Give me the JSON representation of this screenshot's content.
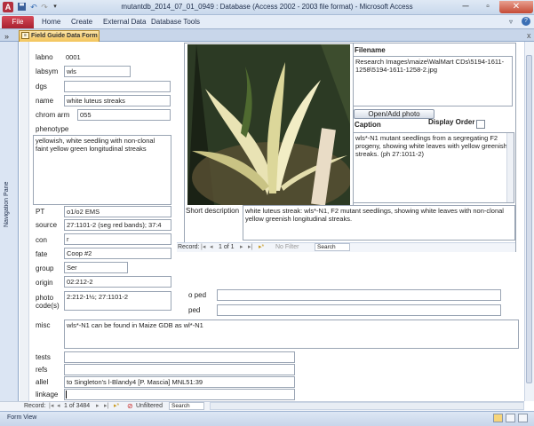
{
  "window": {
    "title": "mutantdb_2014_07_01_0949 : Database (Access 2002 - 2003 file format) - Microsoft Access",
    "app_icon_letter": "A",
    "minimize_glyph": "─",
    "restore_glyph": "▫",
    "close_glyph": "✕"
  },
  "ribbon": {
    "file": "File",
    "tabs": [
      "Home",
      "Create",
      "External Data",
      "Database Tools"
    ],
    "help_glyph": "?"
  },
  "document": {
    "tab_label": "Field Guide Data Form",
    "close_glyph": "x"
  },
  "nav_pane": {
    "label": "Navigation Pane",
    "toggle": "»"
  },
  "form": {
    "labno_label": "labno",
    "labno": "0001",
    "labsym_label": "labsym",
    "labsym": "wls",
    "dgs_label": "dgs",
    "dgs": "",
    "name_label": "name",
    "name": "white luteus streaks",
    "chrom_arm_label": "chrom arm",
    "chrom_arm": "055",
    "phenotype_label": "phenotype",
    "phenotype": "yellowish, white seedling with non-clonal faint yellow green longitudinal streaks",
    "pt_label": "PT",
    "pt": "o1/o2 EMS",
    "source_label": "source",
    "source": "27:1101-2 (seg red bands); 37:4",
    "con_label": "con",
    "con": "r",
    "fate_label": "fate",
    "fate": "Coop #2",
    "group_label": "group",
    "group": "Ser",
    "origin_label": "origin",
    "origin": "02:212-2",
    "photo_codes_label": "photo code(s)",
    "photo_codes": "2:212-1½; 27:1101-2",
    "o_ped_label": "o ped",
    "o_ped": "",
    "ped_label": "ped",
    "ped": "",
    "misc_label": "misc",
    "misc": "wls*-N1 can be found in Maize GDB as wl*-N1",
    "tests_label": "tests",
    "tests": "",
    "refs_label": "refs",
    "refs": "",
    "allel_label": "allel",
    "allel": "to Singleton's l-Blandy4 [P. Mascia] MNL51:39",
    "linkage_label": "linkage",
    "linkage": ""
  },
  "image_subform": {
    "filename_label": "Filename",
    "filename": "Research Images\\maize\\WalMart CDs\\5194-1611-1258\\5194-1611-1258-2.jpg",
    "open_add_button": "Open/Add photo",
    "caption_label": "Caption",
    "display_order_label": "Display Order",
    "caption": "wls*-N1 mutant seedlings from a segregating F2 progeny, showing white leaves with yellow greenish streaks.  (ph 27:1011-2)",
    "short_description_label": "Short description",
    "short_description": "white luteus streak:  wls*-N1, F2 mutant seedlings,  showing white leaves with non-clonal yellow greenish longitudinal streaks."
  },
  "subform_nav": {
    "record_label": "Record:",
    "position": "1 of 1",
    "filter": "No Filter",
    "search": "Search"
  },
  "main_nav": {
    "record_label": "Record:",
    "position": "1 of 3484",
    "filter": "Unfiltered",
    "search": "Search"
  },
  "status": {
    "view": "Form View"
  },
  "colors": {
    "file_tab": "#c0303f",
    "doc_tab": "#f3c45a",
    "ribbon": "#e4ecf7"
  }
}
